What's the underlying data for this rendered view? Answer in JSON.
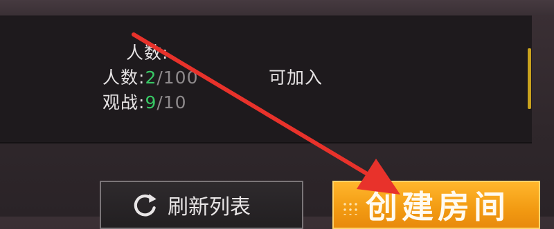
{
  "room": {
    "players_title": "人数:",
    "players_label": "人数:",
    "players_current": "2",
    "players_max": "/100",
    "spectators_label": "观战:",
    "spectators_current": "9",
    "spectators_max": "/10",
    "status": "可加入"
  },
  "buttons": {
    "refresh_label": "刷新列表",
    "create_label": "创建房间"
  },
  "icons": {
    "refresh": "refresh-icon",
    "annotation": "red-arrow-icon"
  },
  "colors": {
    "panel_bg": "#1e1a1d",
    "accent_green": "#38c965",
    "create_button": "#f29a12",
    "annotation_arrow": "#e8322b"
  }
}
